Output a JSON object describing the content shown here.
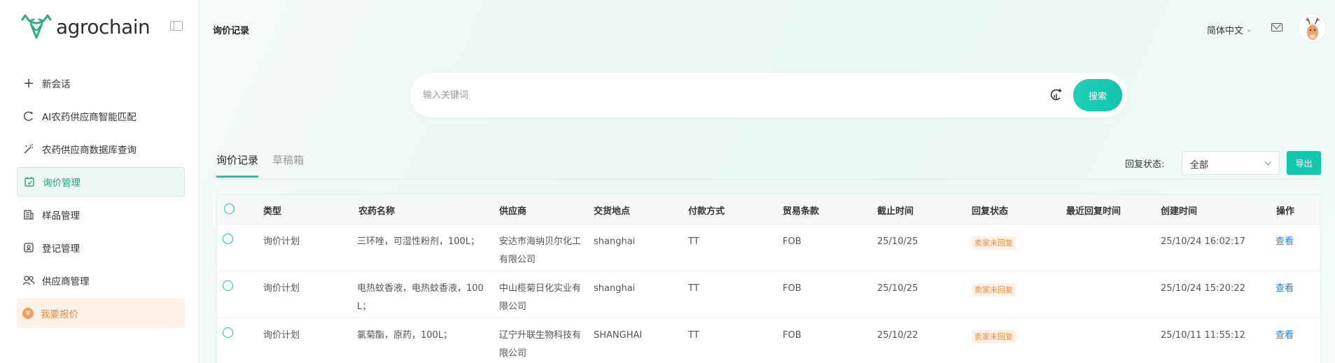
{
  "brand": {
    "name": "agrochain"
  },
  "sidebar": {
    "items": [
      {
        "label": "新会话",
        "icon": "plus-icon"
      },
      {
        "label": "AI农药供应商智能匹配",
        "icon": "ai-match-icon"
      },
      {
        "label": "农药供应商数据库查询",
        "icon": "magic-wand-icon"
      },
      {
        "label": "询价管理",
        "icon": "inquiry-icon",
        "active": true
      },
      {
        "label": "样品管理",
        "icon": "sample-icon"
      },
      {
        "label": "登记管理",
        "icon": "registration-icon"
      },
      {
        "label": "供应商管理",
        "icon": "users-icon"
      },
      {
        "label": "我要报价",
        "icon": "yen-icon"
      }
    ]
  },
  "header": {
    "title": "询价记录",
    "language": "简体中文"
  },
  "search": {
    "placeholder": "输入关键词",
    "button": "搜索"
  },
  "tabs": [
    {
      "label": "询价记录",
      "active": true
    },
    {
      "label": "草稿箱",
      "active": false
    }
  ],
  "filter": {
    "label": "回复状态:",
    "value": "全部",
    "export": "导出"
  },
  "table": {
    "columns": [
      "类型",
      "农药名称",
      "供应商",
      "交货地点",
      "付款方式",
      "贸易条款",
      "截止时间",
      "回复状态",
      "最近回复时间",
      "创建时间",
      "操作"
    ],
    "rows": [
      {
        "type": "询价计划",
        "pesticide_1": "三环唑，可湿性粉剂，100L；",
        "pesticide_2": "",
        "supplier_1": "安达市海纳贝尔化工",
        "supplier_2": "有限公司",
        "location": "shanghai",
        "payment": "TT",
        "terms": "FOB",
        "deadline": "25/10/25",
        "status": "卖家未回复",
        "last_reply": "",
        "created": "25/10/24 16:02:17",
        "action": "查看"
      },
      {
        "type": "询价计划",
        "pesticide_1": "电热蚊香液，电热蚊香液，100",
        "pesticide_2": "L；",
        "supplier_1": "中山榄菊日化实业有",
        "supplier_2": "限公司",
        "location": "shanghai",
        "payment": "TT",
        "terms": "FOB",
        "deadline": "25/10/25",
        "status": "卖家未回复",
        "last_reply": "",
        "created": "25/10/24 15:20:22",
        "action": "查看"
      },
      {
        "type": "询价计划",
        "pesticide_1": "氯菊酯，原药，100L；",
        "pesticide_2": "",
        "supplier_1": "辽宁升联生物科技有",
        "supplier_2": "限公司",
        "location": "SHANGHAI",
        "payment": "TT",
        "terms": "FOB",
        "deadline": "25/10/22",
        "status": "卖家未回复",
        "last_reply": "",
        "created": "25/10/11 11:55:12",
        "action": "查看"
      }
    ]
  },
  "colors": {
    "accent": "#13c6ae",
    "active_nav": "#1aa57a",
    "status_badge": "#f08a3c",
    "link": "#2b7ed6"
  }
}
